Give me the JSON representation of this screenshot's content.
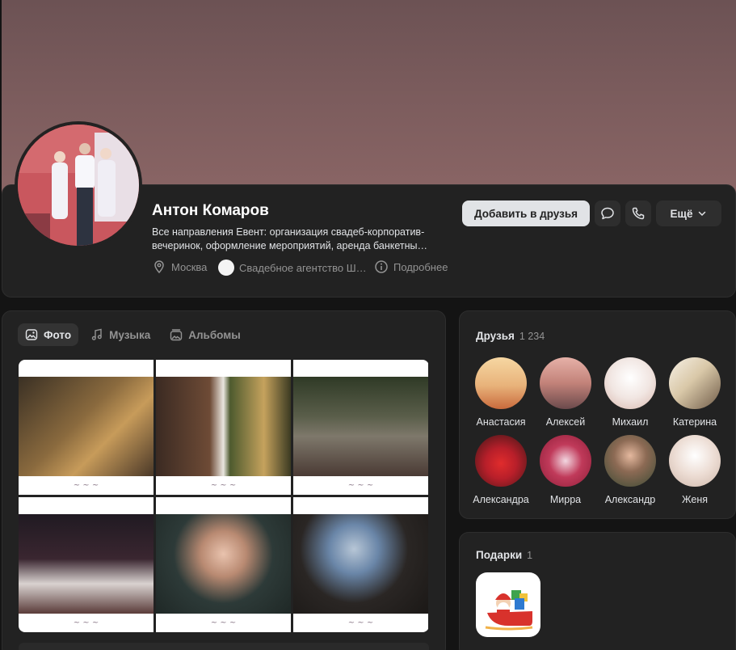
{
  "profile": {
    "name": "Антон Комаров",
    "bio": "Все направления Евент: организация свадеб-корпоратив-\nвечеринок, оформление мероприятий, аренда банкетны…",
    "city": "Москва",
    "work": "Свадебное агентство Ш…",
    "more_info": "Подробнее",
    "add_friend_label": "Добавить в друзья",
    "more_label": "Ещё"
  },
  "tabs": [
    {
      "label": "Фото",
      "icon": "photo-icon",
      "active": true
    },
    {
      "label": "Музыка",
      "icon": "music-icon",
      "active": false
    },
    {
      "label": "Альбомы",
      "icon": "albums-icon",
      "active": false
    }
  ],
  "friends": {
    "title": "Друзья",
    "count": "1 234",
    "items": [
      {
        "name": "Анастасия"
      },
      {
        "name": "Алексей"
      },
      {
        "name": "Михаил"
      },
      {
        "name": "Катерина"
      },
      {
        "name": "Александра"
      },
      {
        "name": "Мирра"
      },
      {
        "name": "Александр"
      },
      {
        "name": "Женя"
      }
    ]
  },
  "gifts": {
    "title": "Подарки",
    "count": "1"
  },
  "colors": {
    "background": "#141414",
    "card": "#222222",
    "accent_button": "#e1e3e6",
    "muted_text": "#939393"
  }
}
